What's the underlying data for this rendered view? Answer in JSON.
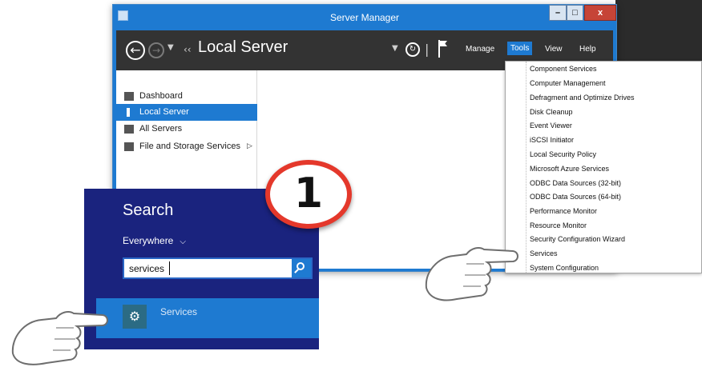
{
  "window": {
    "title": "Server Manager",
    "controls": {
      "minimize": "–",
      "maximize": "□",
      "close": "x"
    }
  },
  "toolbar": {
    "breadcrumb_arrows": "‹‹",
    "page_title": "Local Server",
    "menu": {
      "manage": "Manage",
      "tools": "Tools",
      "view": "View",
      "help": "Help"
    }
  },
  "sidebar": {
    "items": [
      {
        "label": "Dashboard",
        "icon": "dashboard-icon",
        "active": false
      },
      {
        "label": "Local Server",
        "icon": "local-server-icon",
        "active": true
      },
      {
        "label": "All Servers",
        "icon": "all-servers-icon",
        "active": false
      },
      {
        "label": "File and Storage Services",
        "icon": "file-storage-icon",
        "active": false,
        "has_submenu": true
      }
    ],
    "submenu_arrow": "▷"
  },
  "tools_menu": {
    "items": [
      "Component Services",
      "Computer Management",
      "Defragment and Optimize Drives",
      "Disk Cleanup",
      "Event Viewer",
      "iSCSI Initiator",
      "Local Security Policy",
      "Microsoft Azure Services",
      "ODBC Data Sources (32-bit)",
      "ODBC Data Sources (64-bit)",
      "Performance Monitor",
      "Resource Monitor",
      "Security Configuration Wizard",
      "Services",
      "System Configuration"
    ]
  },
  "search": {
    "title": "Search",
    "scope": "Everywhere",
    "scope_chevron": "⌵",
    "query": "services",
    "result": {
      "label": "Services",
      "icon": "services-gear-icon"
    }
  },
  "annotation": {
    "step_number": "1"
  },
  "colors": {
    "accent_blue": "#1e7ad1",
    "search_panel": "#1a237e",
    "toolbar_dark": "#333333",
    "badge_red": "#e4382b"
  }
}
